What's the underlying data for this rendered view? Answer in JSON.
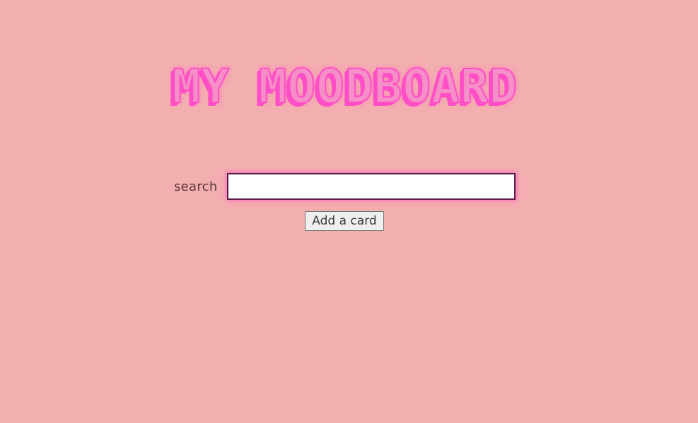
{
  "header": {
    "title": "MY MOODBOARD"
  },
  "search": {
    "label": "search",
    "value": "",
    "placeholder": ""
  },
  "actions": {
    "add_card_label": "Add a card"
  },
  "colors": {
    "background": "#f3aeb0",
    "title_pink": "#ff4fc7",
    "input_glow": "#ff4fc7"
  }
}
